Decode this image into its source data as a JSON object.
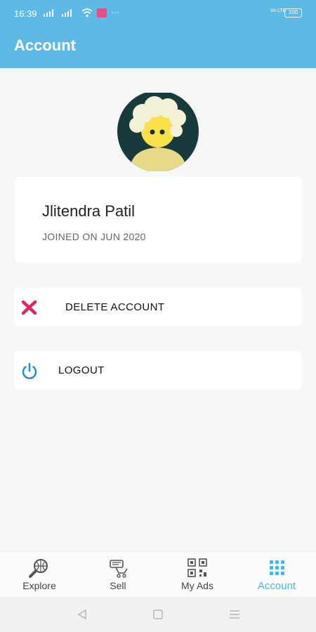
{
  "status": {
    "time": "16:39",
    "notification_dots": "···",
    "volte": "Vo LTE",
    "battery": "100"
  },
  "header": {
    "title": "Account"
  },
  "profile": {
    "name": "Jlitendra Patil",
    "joined": "JOINED ON JUN 2020"
  },
  "actions": {
    "delete_label": "DELETE ACCOUNT",
    "logout_label": "LOGOUT"
  },
  "bottom_nav": {
    "items": [
      {
        "label": "Explore",
        "icon": "explore-icon"
      },
      {
        "label": "Sell",
        "icon": "sell-icon"
      },
      {
        "label": "My Ads",
        "icon": "my-ads-icon"
      },
      {
        "label": "Account",
        "icon": "account-grid-icon"
      }
    ],
    "active": "Account"
  },
  "colors": {
    "primary": "#5fb9e6",
    "delete": "#e0245e",
    "logout": "#2a8fd0",
    "active_tab": "#4fb3e0"
  }
}
